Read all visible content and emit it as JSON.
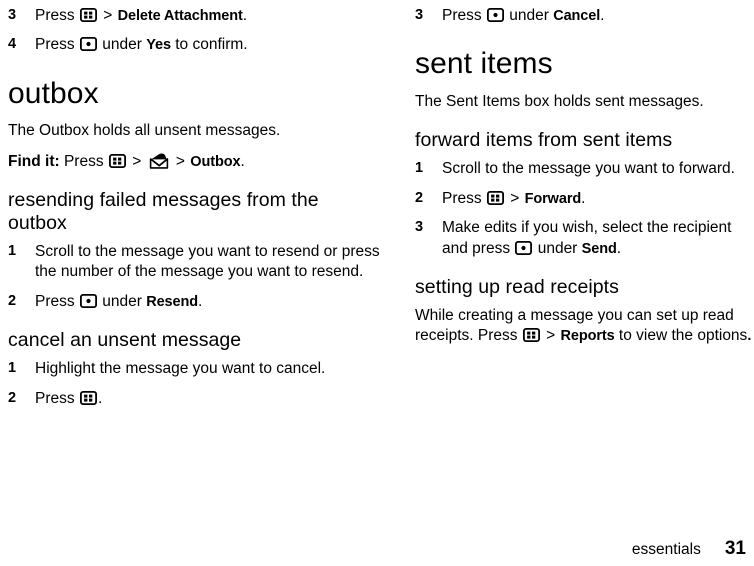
{
  "page": {
    "footer_chapter": "essentials",
    "footer_page_number": "31",
    "background_color": "#ffffff",
    "text_color": "#000000"
  },
  "icons": {
    "menu_key": "menu-key-icon",
    "select_key": "center-select-key-icon",
    "messages_envelope": "envelope-icon"
  },
  "left_column": {
    "top_steps": [
      {
        "number": "3",
        "pre": "Press",
        "icon": "menu-key-icon",
        "mid": ">",
        "term": "Delete Attachment",
        "post": "."
      },
      {
        "number": "4",
        "pre": "Press",
        "icon": "center-select-key-icon",
        "mid": "under",
        "term": "Yes",
        "post": "to confirm."
      }
    ],
    "chapter_heading": "outbox",
    "intro": "The Outbox holds all unsent messages.",
    "find_it": {
      "label": "Find it:",
      "press": "Press",
      "sep1": ">",
      "sep2": ">",
      "term": "Outbox",
      "post": "."
    },
    "section_1": {
      "heading": "resending failed messages from the outbox",
      "steps": [
        {
          "number": "1",
          "text": "Scroll to the message you want to resend or press the number of the message you want to resend."
        },
        {
          "number": "2",
          "pre": "Press",
          "icon": "center-select-key-icon",
          "mid": "under",
          "term": "Resend",
          "post": "."
        }
      ]
    },
    "section_2": {
      "heading": "cancel an unsent message",
      "steps": [
        {
          "number": "1",
          "text": "Highlight the message you want to cancel."
        },
        {
          "number": "2",
          "pre": "Press",
          "icon": "menu-key-icon",
          "post": "."
        }
      ]
    }
  },
  "right_column": {
    "top_steps": [
      {
        "number": "3",
        "pre": "Press",
        "icon": "center-select-key-icon",
        "mid": "under",
        "term": "Cancel",
        "post": "."
      }
    ],
    "chapter_heading": "sent items",
    "intro": "The Sent Items box holds sent messages.",
    "section_1": {
      "heading": "forward items from sent items",
      "steps": [
        {
          "number": "1",
          "text": "Scroll to the message you want to forward."
        },
        {
          "number": "2",
          "pre": "Press",
          "icon": "menu-key-icon",
          "mid": ">",
          "term": "Forward",
          "post": "."
        },
        {
          "number": "3",
          "pre": "Make edits if you wish, select the recipient and press",
          "icon": "center-select-key-icon",
          "mid": "under",
          "term": "Send",
          "post": "."
        }
      ]
    },
    "section_2": {
      "heading": "setting up read receipts",
      "body": {
        "pre": "While creating a message you can set up read receipts. Press",
        "icon": "menu-key-icon",
        "mid": ">",
        "term": "Reports",
        "post": "to view the options",
        "end": "."
      }
    }
  }
}
